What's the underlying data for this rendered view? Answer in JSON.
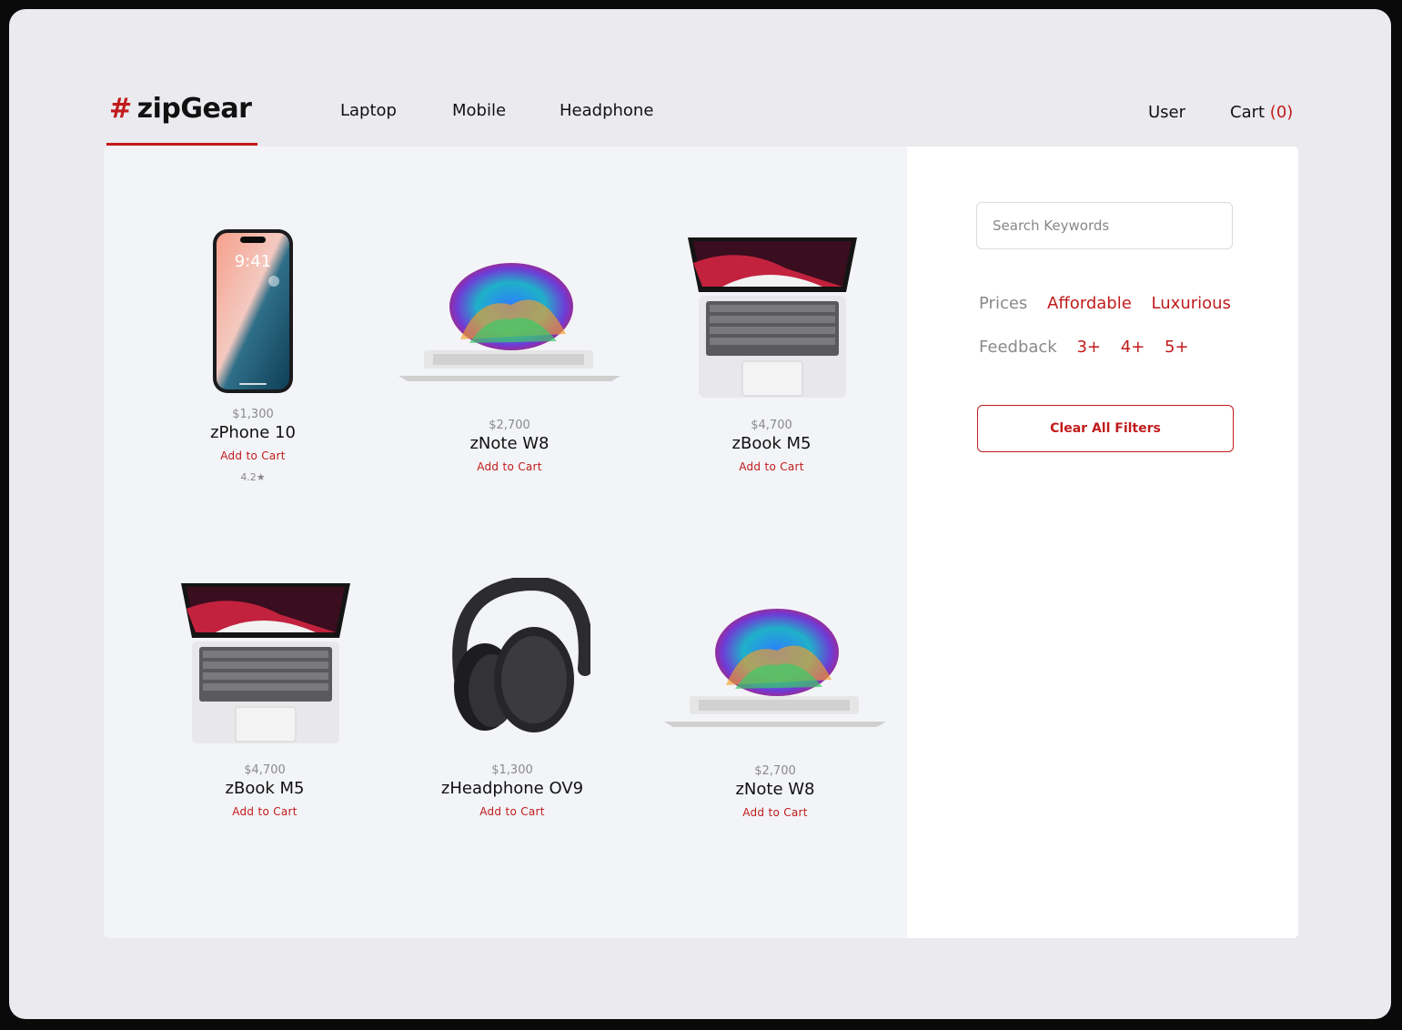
{
  "brand": {
    "hash": "#",
    "name": "zipGear"
  },
  "nav": {
    "laptop": "Laptop",
    "mobile": "Mobile",
    "headphone": "Headphone"
  },
  "account": {
    "user": "User",
    "cart_label": "Cart",
    "cart_count": "(0)"
  },
  "products": [
    {
      "price": "$1,300",
      "name": "zPhone 10",
      "add": "Add to Cart",
      "rating": "4.2★",
      "icon": "phone"
    },
    {
      "price": "$2,700",
      "name": "zNote W8",
      "add": "Add to Cart",
      "icon": "laptop-front"
    },
    {
      "price": "$4,700",
      "name": "zBook M5",
      "add": "Add to Cart",
      "icon": "laptop-top"
    },
    {
      "price": "$4,700",
      "name": "zBook M5",
      "add": "Add to Cart",
      "icon": "laptop-top"
    },
    {
      "price": "$1,300",
      "name": "zHeadphone OV9",
      "add": "Add to Cart",
      "icon": "headphone"
    },
    {
      "price": "$2,700",
      "name": "zNote W8",
      "add": "Add to Cart",
      "icon": "laptop-front"
    }
  ],
  "filters": {
    "search_placeholder": "Search Keywords",
    "prices_label": "Prices",
    "prices_options": [
      "Affordable",
      "Luxurious"
    ],
    "feedback_label": "Feedback",
    "feedback_options": [
      "3+",
      "4+",
      "5+"
    ],
    "clear_label": "Clear All Filters"
  },
  "colors": {
    "accent": "#c11b1b",
    "page_bg": "#ebeaee",
    "products_bg": "#f3f4f7"
  }
}
